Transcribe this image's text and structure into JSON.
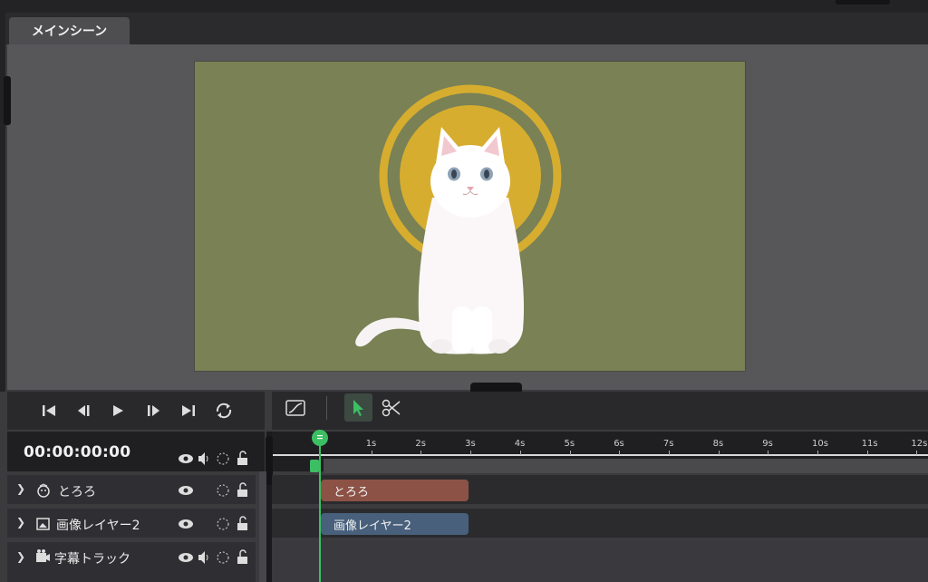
{
  "scene_tab": {
    "label": "メインシーン"
  },
  "playback": {
    "timecode": "00:00:00:00",
    "buttons": [
      "skip-to-start",
      "step-back",
      "play",
      "step-forward",
      "skip-to-end",
      "loop"
    ]
  },
  "toolbar": {
    "tools": [
      "curve-editor",
      "select",
      "cut"
    ],
    "active_tool": "select"
  },
  "ruler": {
    "labels": [
      "1s",
      "2s",
      "3s",
      "4s",
      "5s",
      "6s",
      "7s",
      "8s",
      "9s",
      "10s",
      "11s",
      "12s"
    ]
  },
  "layers": [
    {
      "name": "とろろ",
      "icon": "character-icon",
      "clip_label": "とろろ",
      "clip_color": "#8c5246"
    },
    {
      "name": "画像レイヤー2",
      "icon": "image-icon",
      "clip_label": "画像レイヤー2",
      "clip_color": "#48607c"
    },
    {
      "name": "字幕トラック",
      "icon": "subtitle-track-icon",
      "clip_label": "",
      "clip_color": ""
    }
  ],
  "colors": {
    "accent": "#3bbf62",
    "canvas_bg": "#798155",
    "halo": "#d6ad2f"
  }
}
